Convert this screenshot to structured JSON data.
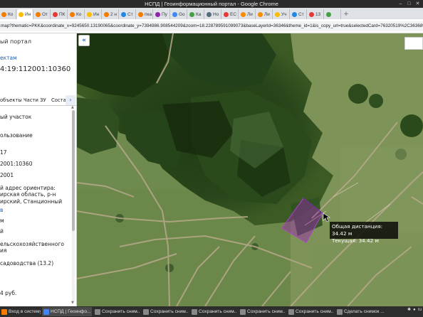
{
  "window": {
    "title": "НСПД | Геоинформационный портал - Google Chrome"
  },
  "tabs": [
    {
      "label": "Ко",
      "color": "#f57c00"
    },
    {
      "label": "Ин",
      "color": "#fbbc04"
    },
    {
      "label": "От",
      "color": "#f57c00"
    },
    {
      "label": "ПК",
      "color": "#e53935"
    },
    {
      "label": "Ко",
      "color": "#f57c00"
    },
    {
      "label": "Ин",
      "color": "#fbbc04"
    },
    {
      "label": "2 н",
      "color": "#f57c00"
    },
    {
      "label": "Ст",
      "color": "#1e88e5"
    },
    {
      "label": "пка",
      "color": "#f57c00"
    },
    {
      "label": "Пу",
      "color": "#8e24aa"
    },
    {
      "label": "Go",
      "color": "#4285f4"
    },
    {
      "label": "Ка",
      "color": "#43a047"
    },
    {
      "label": "Но",
      "color": "#546e7a"
    },
    {
      "label": "ЕС",
      "color": "#e53935"
    },
    {
      "label": "Ли",
      "color": "#fb8c00"
    },
    {
      "label": "Ли",
      "color": "#fb8c00"
    },
    {
      "label": "Уч",
      "color": "#fbbc04"
    },
    {
      "label": "Ст",
      "color": "#1e88e5"
    },
    {
      "label": "13",
      "color": "#e53935"
    },
    {
      "label": "",
      "color": "#43a047"
    }
  ],
  "address_bar": {
    "url": "map?thematic=PKK&coordinate_x=9245650.13190065&coordinate_y=7394986.908544209&zoom=18.228789591099073&baseLayerId=36346&theme_id=1&is_copy_url=true&selectedCard=76320519%2C36368%2C54%3A19%3A2"
  },
  "panel": {
    "portal": "ый портал",
    "back_link": "ектам",
    "cadastral_number": "4:19:112001:10360",
    "tabs": [
      "объекты",
      "Части ЗУ",
      "Состав"
    ],
    "tab_arrow": "›",
    "lines": [
      {
        "text": "ый участок",
        "link": false
      },
      {
        "text": "ользование",
        "link": false
      },
      {
        "text": "17",
        "link": false
      },
      {
        "text": "2001:10360",
        "link": false
      },
      {
        "text": "2001",
        "link": false
      },
      {
        "text": "й адрес ориентира:",
        "link": false
      },
      {
        "text": "ирская область, р-н",
        "link": false
      },
      {
        "text": "ирский, Станционный",
        "link": false
      },
      {
        "text": "в",
        "link": true
      },
      {
        "text": "м",
        "link": false
      },
      {
        "text": "й",
        "link": false
      },
      {
        "text": "ельскохозяйственного",
        "link": false
      },
      {
        "text": "ия",
        "link": false
      },
      {
        "text": "садоводства (13.2)",
        "link": false
      },
      {
        "text": "4 руб.",
        "link": false
      }
    ]
  },
  "map": {
    "collapse_icon": "«",
    "tooltip": {
      "total_distance": "Общая дистанция: 34.42 м",
      "current": "Текущая: 34.42 м"
    },
    "parcel_color": "#9c27b0"
  },
  "taskbar": [
    {
      "label": "Вход в систему -",
      "color": "#f57c00"
    },
    {
      "label": "НСПД | Геоинфо...",
      "color": "#4285f4",
      "active": true
    },
    {
      "label": "Сохранить сним...",
      "color": "#888888"
    },
    {
      "label": "Сохранить сним...",
      "color": "#888888"
    },
    {
      "label": "Сохранить сним...",
      "color": "#888888"
    },
    {
      "label": "Сохранить сним...",
      "color": "#888888"
    },
    {
      "label": "Сохранить сним...",
      "color": "#888888"
    },
    {
      "label": "Сделать снимок ...",
      "color": "#888888"
    }
  ],
  "tray": {
    "lang": "ru"
  }
}
